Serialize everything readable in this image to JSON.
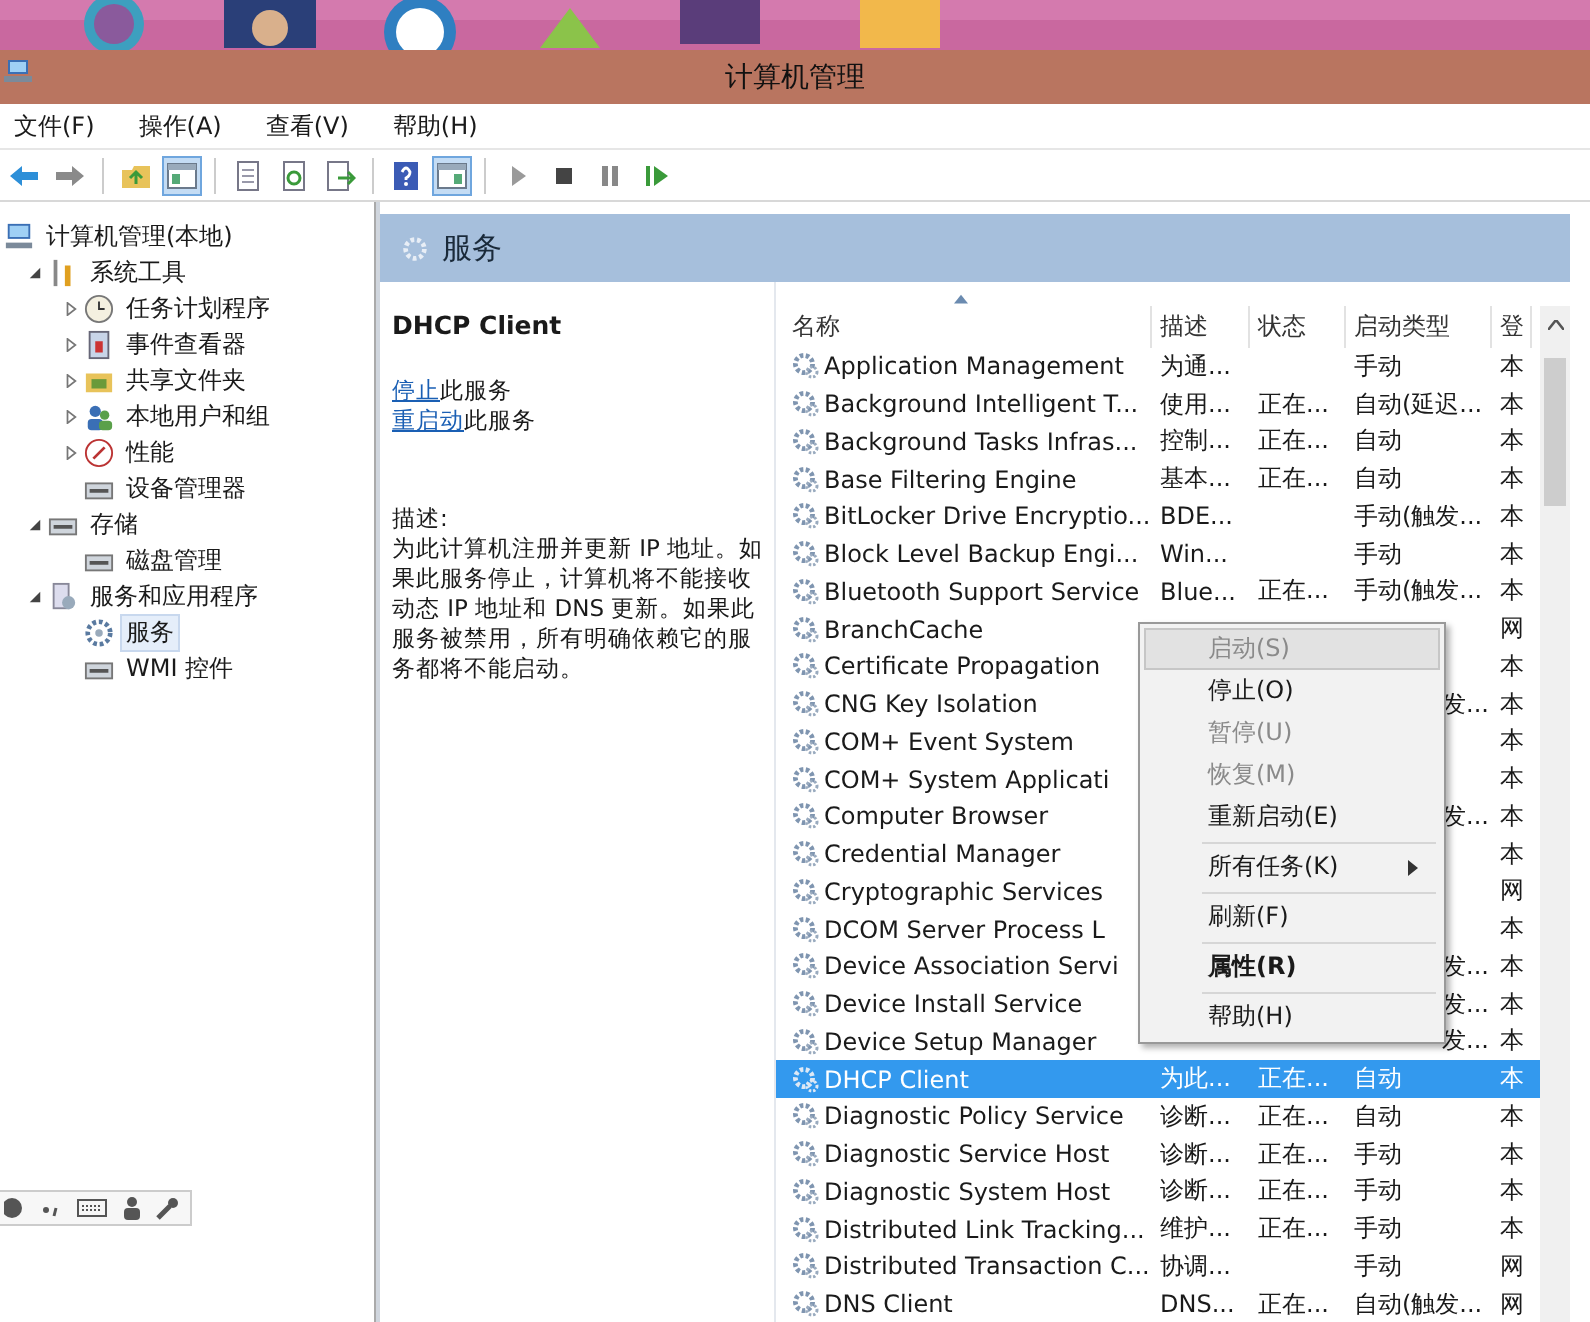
{
  "window": {
    "title": "计算机管理"
  },
  "menu_bar": [
    "文件(F)",
    "操作(A)",
    "查看(V)",
    "帮助(H)"
  ],
  "toolbar": [
    {
      "kind": "back",
      "selected": false
    },
    {
      "kind": "forward",
      "selected": false
    },
    {
      "kind": "sep"
    },
    {
      "kind": "folder-up",
      "selected": false
    },
    {
      "kind": "tree-pane",
      "selected": true
    },
    {
      "kind": "sep"
    },
    {
      "kind": "properties",
      "selected": false
    },
    {
      "kind": "refresh",
      "selected": false
    },
    {
      "kind": "export",
      "selected": false
    },
    {
      "kind": "sep"
    },
    {
      "kind": "help",
      "selected": false
    },
    {
      "kind": "action-pane",
      "selected": true
    },
    {
      "kind": "sep"
    },
    {
      "kind": "play",
      "selected": false
    },
    {
      "kind": "stop",
      "selected": false
    },
    {
      "kind": "pause",
      "selected": false
    },
    {
      "kind": "resume",
      "selected": false
    }
  ],
  "tree": [
    {
      "label": "计算机管理(本地)",
      "selected": false,
      "children": [
        {
          "label": "系统工具",
          "expanded": true,
          "selected": false,
          "children": [
            {
              "label": "任务计划程序",
              "expanded": false,
              "selected": false
            },
            {
              "label": "事件查看器",
              "expanded": false,
              "selected": false
            },
            {
              "label": "共享文件夹",
              "expanded": false,
              "selected": false
            },
            {
              "label": "本地用户和组",
              "expanded": false,
              "selected": false
            },
            {
              "label": "性能",
              "expanded": false,
              "selected": false
            },
            {
              "label": "设备管理器",
              "selected": false
            }
          ]
        },
        {
          "label": "存储",
          "expanded": true,
          "selected": false,
          "children": [
            {
              "label": "磁盘管理",
              "selected": false
            }
          ]
        },
        {
          "label": "服务和应用程序",
          "expanded": true,
          "selected": false,
          "children": [
            {
              "label": "服务",
              "selected": true
            },
            {
              "label": "WMI 控件",
              "selected": false
            }
          ]
        }
      ]
    }
  ],
  "panel_header": "服务",
  "detail": {
    "title": "DHCP Client",
    "actions": [
      {
        "link": "停止",
        "text": "此服务"
      },
      {
        "link": "重启动",
        "text": "此服务"
      }
    ],
    "description_label": "描述:",
    "description": "为此计算机注册并更新 IP 地址。如果此服务停止，计算机将不能接收动态 IP 地址和 DNS 更新。如果此服务被禁用，所有明确依赖它的服务都将不能启动。"
  },
  "table": {
    "columns": [
      "名称",
      "描述",
      "状态",
      "启动类型",
      "登"
    ],
    "rows": [
      {
        "cells": [
          "Application Management",
          "为通...",
          "",
          "手动",
          "本"
        ],
        "selected": false
      },
      {
        "cells": [
          "Background Intelligent T...",
          "使用...",
          "正在...",
          "自动(延迟...",
          "本"
        ],
        "selected": false
      },
      {
        "cells": [
          "Background Tasks Infras...",
          "控制...",
          "正在...",
          "自动",
          "本"
        ],
        "selected": false
      },
      {
        "cells": [
          "Base Filtering Engine",
          "基本...",
          "正在...",
          "自动",
          "本"
        ],
        "selected": false
      },
      {
        "cells": [
          "BitLocker Drive Encryptio...",
          "BDE...",
          "",
          "手动(触发...",
          "本"
        ],
        "selected": false
      },
      {
        "cells": [
          "Block Level Backup Engi...",
          "Win...",
          "",
          "手动",
          "本"
        ],
        "selected": false
      },
      {
        "cells": [
          "Bluetooth Support Service",
          "Blue...",
          "正在...",
          "手动(触发...",
          "本"
        ],
        "selected": false
      },
      {
        "cells": [
          "BranchCache",
          "",
          "",
          "",
          "网"
        ],
        "selected": false
      },
      {
        "cells": [
          "Certificate Propagation",
          "",
          "",
          "",
          "本"
        ],
        "selected": false
      },
      {
        "cells": [
          "CNG Key Isolation",
          "",
          "",
          "发...",
          "本"
        ],
        "selected": false,
        "kind": "under-menu"
      },
      {
        "cells": [
          "COM+ Event System",
          "",
          "",
          "",
          "本"
        ],
        "selected": false
      },
      {
        "cells": [
          "COM+ System Applicati",
          "",
          "",
          "",
          "本"
        ],
        "selected": false
      },
      {
        "cells": [
          "Computer Browser",
          "",
          "",
          "发...",
          "本"
        ],
        "selected": false,
        "kind": "under-menu"
      },
      {
        "cells": [
          "Credential Manager",
          "",
          "",
          "",
          "本"
        ],
        "selected": false
      },
      {
        "cells": [
          "Cryptographic Services",
          "",
          "",
          "",
          "网"
        ],
        "selected": false
      },
      {
        "cells": [
          "DCOM Server Process L",
          "",
          "",
          "",
          "本"
        ],
        "selected": false
      },
      {
        "cells": [
          "Device Association Servi",
          "",
          "",
          "发...",
          "本"
        ],
        "selected": false,
        "kind": "under-menu"
      },
      {
        "cells": [
          "Device Install Service",
          "",
          "",
          "发...",
          "本"
        ],
        "selected": false,
        "kind": "under-menu"
      },
      {
        "cells": [
          "Device Setup Manager",
          "",
          "",
          "发...",
          "本"
        ],
        "selected": false,
        "kind": "under-menu"
      },
      {
        "cells": [
          "DHCP Client",
          "为此...",
          "正在...",
          "自动",
          "本"
        ],
        "selected": true
      },
      {
        "cells": [
          "Diagnostic Policy Service",
          "诊断...",
          "正在...",
          "自动",
          "本"
        ],
        "selected": false
      },
      {
        "cells": [
          "Diagnostic Service Host",
          "诊断...",
          "正在...",
          "手动",
          "本"
        ],
        "selected": false
      },
      {
        "cells": [
          "Diagnostic System Host",
          "诊断...",
          "正在...",
          "手动",
          "本"
        ],
        "selected": false
      },
      {
        "cells": [
          "Distributed Link Tracking...",
          "维护...",
          "正在...",
          "手动",
          "本"
        ],
        "selected": false
      },
      {
        "cells": [
          "Distributed Transaction C...",
          "协调...",
          "",
          "手动",
          "网"
        ],
        "selected": false
      },
      {
        "cells": [
          "DNS Client",
          "DNS...",
          "正在...",
          "自动(触发...",
          "网"
        ],
        "selected": false
      }
    ]
  },
  "context_menu": [
    {
      "kind": "item",
      "label": "启动(S)",
      "disabled": true,
      "highlighted": true
    },
    {
      "kind": "item",
      "label": "停止(O)",
      "disabled": false,
      "highlighted": false
    },
    {
      "kind": "item",
      "label": "暂停(U)",
      "disabled": true,
      "highlighted": false
    },
    {
      "kind": "item",
      "label": "恢复(M)",
      "disabled": true,
      "highlighted": false
    },
    {
      "kind": "item",
      "label": "重新启动(E)",
      "disabled": false,
      "highlighted": false
    },
    {
      "kind": "separator"
    },
    {
      "kind": "submenu",
      "label": "所有任务(K)",
      "disabled": false,
      "highlighted": false
    },
    {
      "kind": "separator"
    },
    {
      "kind": "item",
      "label": "刷新(F)",
      "disabled": false,
      "highlighted": false
    },
    {
      "kind": "separator"
    },
    {
      "kind": "default",
      "label": "属性(R)",
      "disabled": false,
      "highlighted": false
    },
    {
      "kind": "separator"
    },
    {
      "kind": "item",
      "label": "帮助(H)",
      "disabled": false,
      "highlighted": false
    }
  ]
}
